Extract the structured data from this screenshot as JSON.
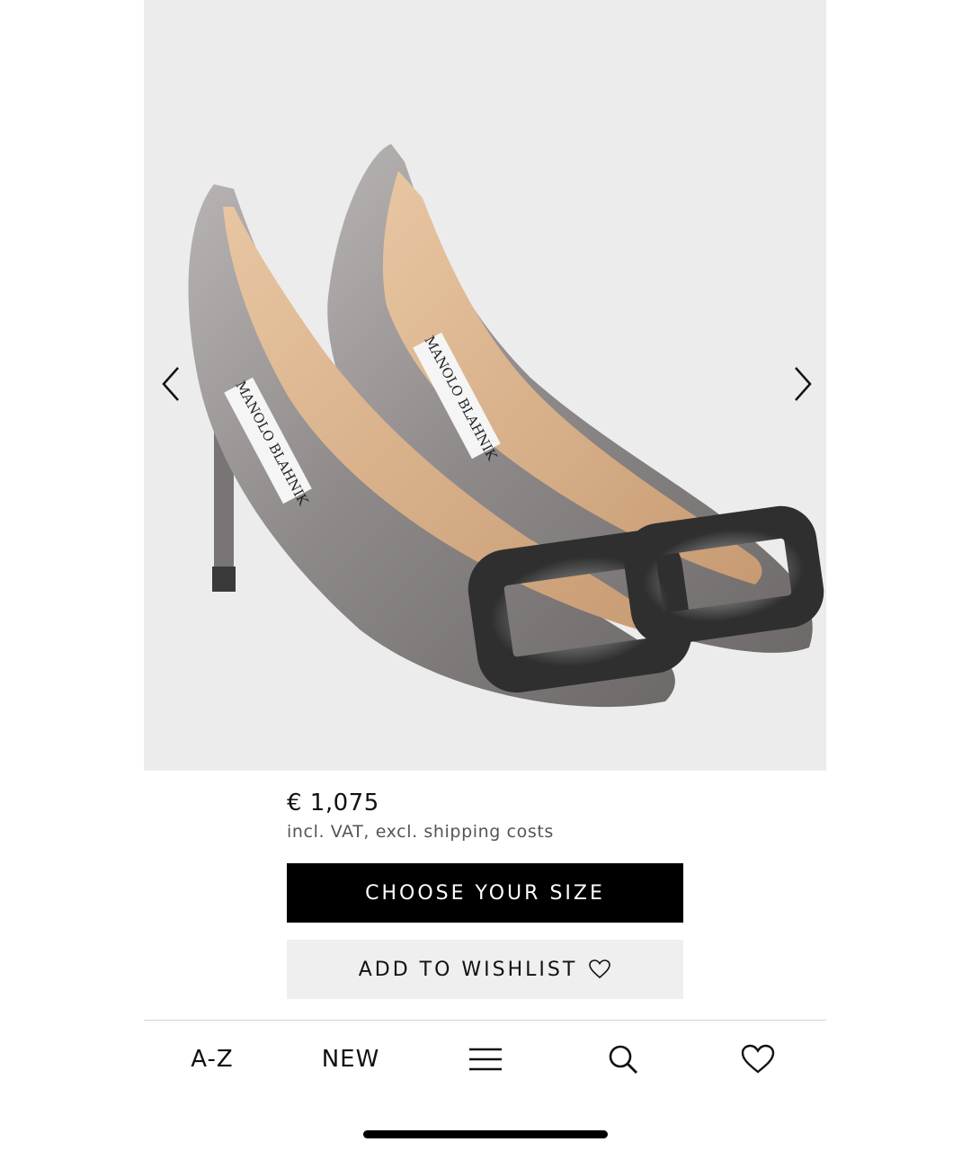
{
  "product": {
    "image_alt": "Manolo Blahnik satin pumps with crystal buckle",
    "insole_brand": "MANOLO BLAHNIK",
    "price": "€ 1,075",
    "price_note": "incl. VAT, excl. shipping costs"
  },
  "actions": {
    "choose_size": "CHOOSE YOUR SIZE",
    "add_to_wishlist": "ADD TO WISHLIST"
  },
  "tabbar": {
    "az": "A-Z",
    "new": "NEW"
  },
  "icons": {
    "prev": "chevron-left-icon",
    "next": "chevron-right-icon",
    "wishlist": "heart-outline-icon",
    "menu": "hamburger-menu-icon",
    "search": "search-icon",
    "favorites": "heart-outline-icon"
  },
  "colors": {
    "primary_button": "#000000",
    "secondary_button": "#efefef",
    "image_background": "#ececec"
  }
}
